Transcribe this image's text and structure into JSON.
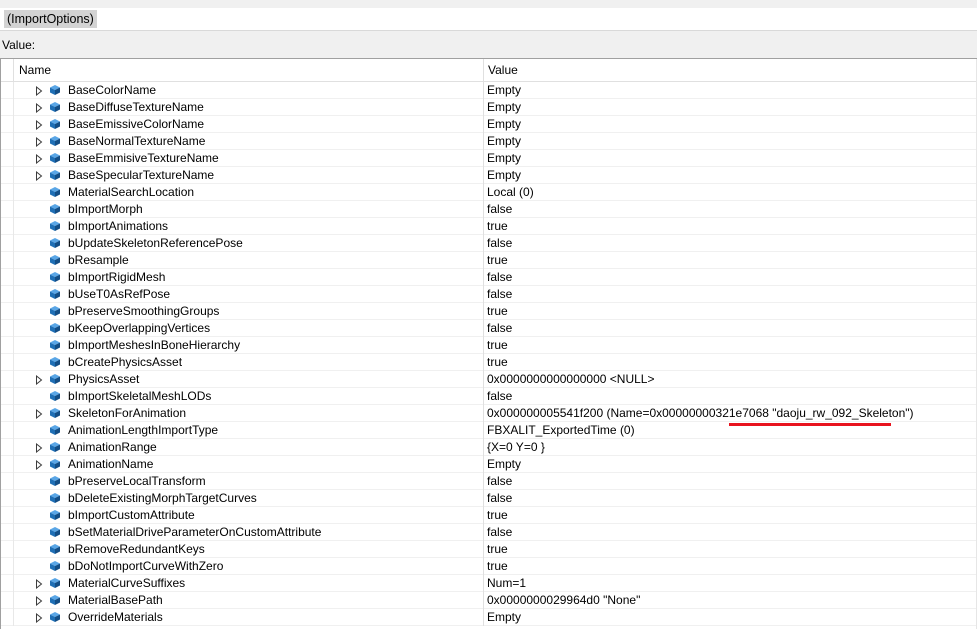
{
  "expression": {
    "text": "(ImportOptions)"
  },
  "value_label": "Value:",
  "table": {
    "columns": [
      "Name",
      "Value"
    ],
    "rows": [
      {
        "name": "BaseColorName",
        "value": "Empty",
        "expandable": true
      },
      {
        "name": "BaseDiffuseTextureName",
        "value": "Empty",
        "expandable": true
      },
      {
        "name": "BaseEmissiveColorName",
        "value": "Empty",
        "expandable": true
      },
      {
        "name": "BaseNormalTextureName",
        "value": "Empty",
        "expandable": true
      },
      {
        "name": "BaseEmmisiveTextureName",
        "value": "Empty",
        "expandable": true
      },
      {
        "name": "BaseSpecularTextureName",
        "value": "Empty",
        "expandable": true
      },
      {
        "name": "MaterialSearchLocation",
        "value": "Local (0)",
        "expandable": false
      },
      {
        "name": "bImportMorph",
        "value": "false",
        "expandable": false
      },
      {
        "name": "bImportAnimations",
        "value": "true",
        "expandable": false
      },
      {
        "name": "bUpdateSkeletonReferencePose",
        "value": "false",
        "expandable": false
      },
      {
        "name": "bResample",
        "value": "true",
        "expandable": false
      },
      {
        "name": "bImportRigidMesh",
        "value": "false",
        "expandable": false
      },
      {
        "name": "bUseT0AsRefPose",
        "value": "false",
        "expandable": false
      },
      {
        "name": "bPreserveSmoothingGroups",
        "value": "true",
        "expandable": false
      },
      {
        "name": "bKeepOverlappingVertices",
        "value": "false",
        "expandable": false
      },
      {
        "name": "bImportMeshesInBoneHierarchy",
        "value": "true",
        "expandable": false
      },
      {
        "name": "bCreatePhysicsAsset",
        "value": "true",
        "expandable": false
      },
      {
        "name": "PhysicsAsset",
        "value": "0x0000000000000000 <NULL>",
        "expandable": true
      },
      {
        "name": "bImportSkeletalMeshLODs",
        "value": "false",
        "expandable": false
      },
      {
        "name": "SkeletonForAnimation",
        "value": "0x000000005541f200 (Name=0x00000000321e7068 \"daoju_rw_092_Skeleton\")",
        "expandable": true
      },
      {
        "name": "AnimationLengthImportType",
        "value": "FBXALIT_ExportedTime (0)",
        "expandable": false
      },
      {
        "name": "AnimationRange",
        "value": "{X=0 Y=0 }",
        "expandable": true
      },
      {
        "name": "AnimationName",
        "value": "Empty",
        "expandable": true
      },
      {
        "name": "bPreserveLocalTransform",
        "value": "false",
        "expandable": false
      },
      {
        "name": "bDeleteExistingMorphTargetCurves",
        "value": "false",
        "expandable": false
      },
      {
        "name": "bImportCustomAttribute",
        "value": "true",
        "expandable": false
      },
      {
        "name": "bSetMaterialDriveParameterOnCustomAttribute",
        "value": "false",
        "expandable": false
      },
      {
        "name": "bRemoveRedundantKeys",
        "value": "true",
        "expandable": false
      },
      {
        "name": "bDoNotImportCurveWithZero",
        "value": "true",
        "expandable": false
      },
      {
        "name": "MaterialCurveSuffixes",
        "value": "Num=1",
        "expandable": true
      },
      {
        "name": "MaterialBasePath",
        "value": "0x0000000029964d0 \"None\"",
        "expandable": true
      },
      {
        "name": "OverrideMaterials",
        "value": "Empty",
        "expandable": true
      }
    ]
  },
  "colors": {
    "object_icon": "#1f6fb5",
    "annotation_underline": "#e8141e",
    "selection_highlight": "#d3d3d3"
  },
  "icons": {
    "expander": "triangle-right-icon",
    "property": "cube-icon"
  }
}
